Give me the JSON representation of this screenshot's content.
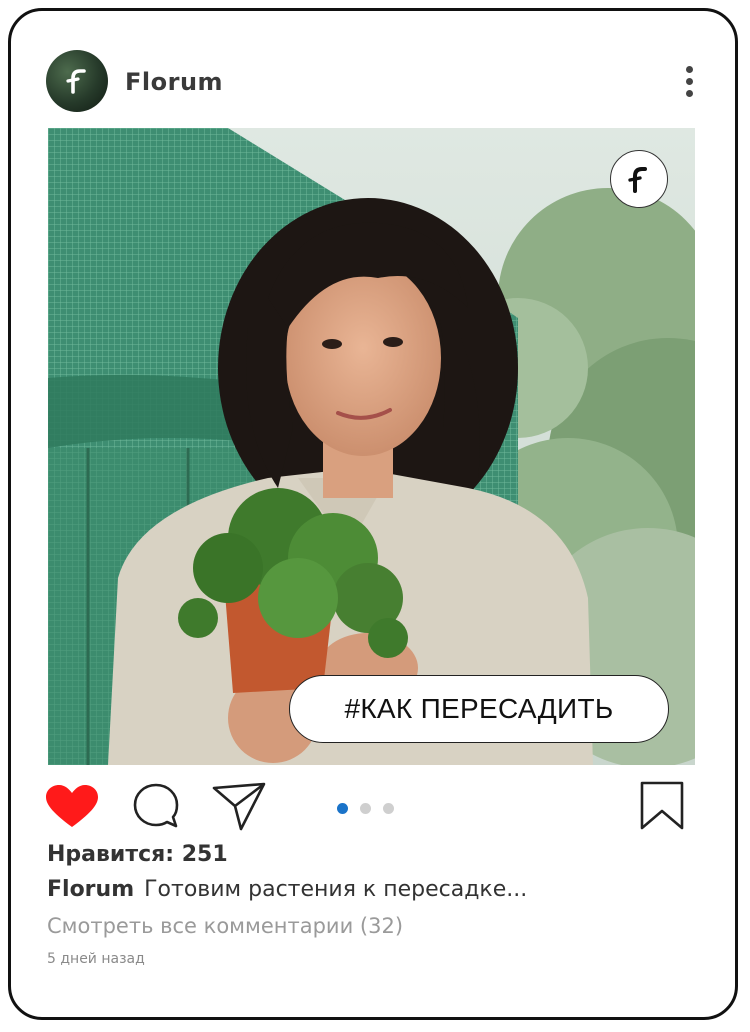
{
  "post": {
    "username": "Florum",
    "avatar_icon": "florum-logo-icon",
    "menu_icon": "more-vertical-icon",
    "photo_badge_icon": "florum-logo-icon",
    "hashtag": "#КАК ПЕРЕСАДИТЬ",
    "like_color": "#ff1a1a",
    "carousel": {
      "count": 3,
      "active": 1,
      "active_color": "#1a73c9"
    },
    "likes_text": "Нравится: 251",
    "caption_user": "Florum",
    "caption_text": "Готовим растения к пересадке...",
    "comments_link": "Смотреть все комментарии (32)",
    "time_ago": "5 дней назад"
  }
}
